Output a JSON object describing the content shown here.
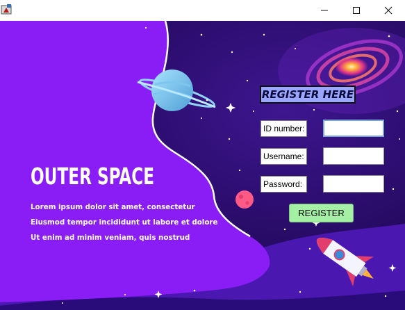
{
  "window": {
    "app_icon": "java-cup-icon",
    "controls": [
      "minimize-icon",
      "maximize-icon",
      "close-icon"
    ]
  },
  "hero": {
    "title": "OUTER SPACE",
    "lines": [
      "Lorem ipsum dolor sit amet, consectetur",
      "Eiusmod tempor incididunt ut labore et dolore",
      "Ut enim ad minim veniam, quis nostrud"
    ]
  },
  "form": {
    "header": "REGISTER HERE",
    "id_label": "ID number:",
    "id_value": "",
    "username_label": "Username:",
    "username_value": "",
    "password_label": "Password:",
    "password_value": "",
    "submit_label": "REGISTER"
  },
  "colors": {
    "purple_panel": "#8a1df5",
    "space_background": "#2a0d6b",
    "header_fill": "#9aa6ff",
    "register_button": "#a4f0a4"
  }
}
